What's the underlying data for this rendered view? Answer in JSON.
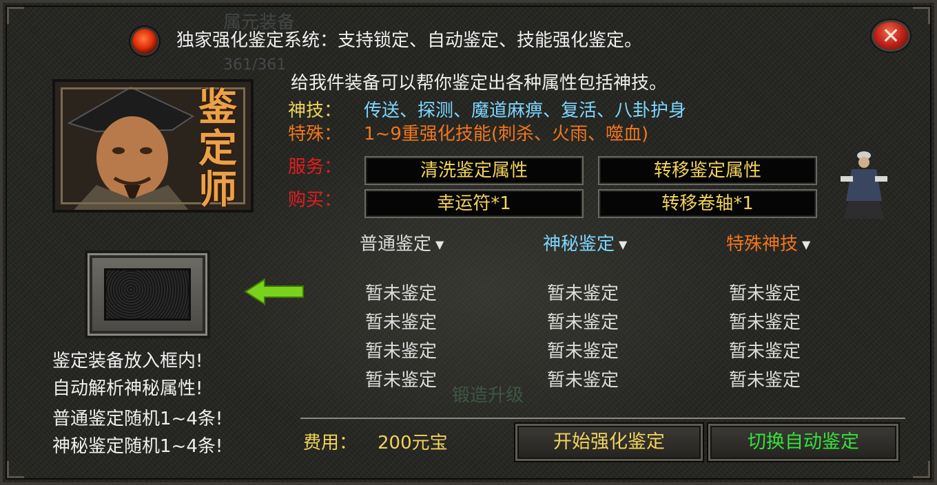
{
  "header": {
    "title": "独家强化鉴定系统：支持锁定、自动鉴定、技能强化鉴定。",
    "background_ghost_text": [
      "属元装备",
      "361/361"
    ]
  },
  "intro": "给我件装备可以帮你鉴定出各种属性包括神技。",
  "skills": {
    "label": "神技：",
    "list": "传送、探测、魔道麻痹、复活、八卦护身"
  },
  "special": {
    "label": "特殊：",
    "desc": "1~9重强化技能(刺杀、火雨、噬血)"
  },
  "services": {
    "label": "服务：",
    "buttons": [
      "清洗鉴定属性",
      "转移鉴定属性"
    ]
  },
  "purchase": {
    "label": "购买：",
    "buttons": [
      "幸运符*1",
      "转移卷轴*1"
    ]
  },
  "portrait": {
    "chars": [
      "鉴",
      "定",
      "师"
    ]
  },
  "columns": [
    {
      "title": "普通鉴定",
      "color": "#dcdcdc",
      "rows": [
        "暂未鉴定",
        "暂未鉴定",
        "暂未鉴定",
        "暂未鉴定"
      ]
    },
    {
      "title": "神秘鉴定",
      "color": "#7fd6ff",
      "rows": [
        "暂未鉴定",
        "暂未鉴定",
        "暂未鉴定",
        "暂未鉴定"
      ]
    },
    {
      "title": "特殊神技",
      "color": "#f2761d",
      "rows": [
        "暂未鉴定",
        "暂未鉴定",
        "暂未鉴定",
        "暂未鉴定"
      ]
    }
  ],
  "instructions": [
    "鉴定装备放入框内!",
    "自动解析神秘属性!",
    "普通鉴定随机1~4条!",
    "神秘鉴定随机1~4条!"
  ],
  "ghost_text": "锻造升级",
  "cost": {
    "label": "费用：",
    "value": "200元宝"
  },
  "actions": {
    "start": "开始强化鉴定",
    "auto": "切换自动鉴定"
  },
  "icons": {
    "close": "close-icon",
    "orb": "red-orb-icon",
    "arrow": "green-arrow-icon",
    "dropdown": "chevron-down-icon"
  },
  "colors": {
    "gold": "#f2d35a",
    "orange": "#f2761d",
    "cyan": "#7fd6ff",
    "red": "#e41e1e",
    "green": "#35e23a"
  }
}
